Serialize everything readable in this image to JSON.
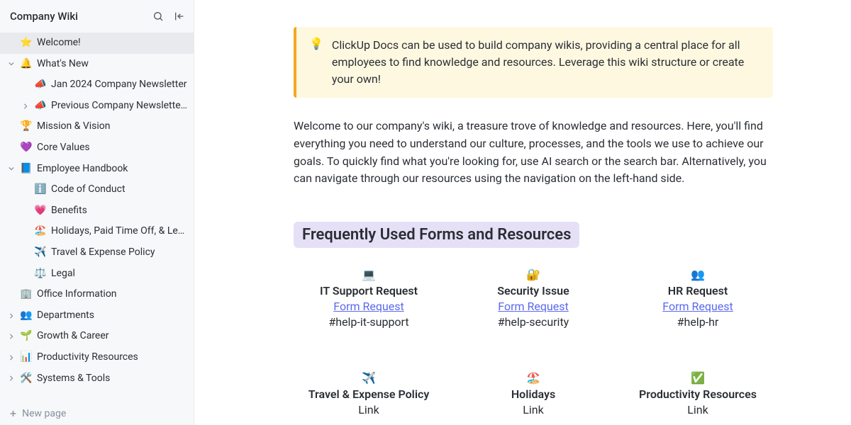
{
  "sidebar": {
    "title": "Company Wiki",
    "new_page_label": "New page",
    "items": [
      {
        "label": "Welcome!",
        "icon": "⭐",
        "depth": 1,
        "expandable": false,
        "expanded": false,
        "active": true
      },
      {
        "label": "What's New",
        "icon": "🔔",
        "depth": 1,
        "expandable": true,
        "expanded": true,
        "active": false
      },
      {
        "label": "Jan 2024 Company Newsletter",
        "icon": "📣",
        "depth": 2,
        "expandable": false,
        "expanded": false,
        "active": false
      },
      {
        "label": "Previous Company Newsletters",
        "icon": "📣",
        "depth": 2,
        "expandable": true,
        "expanded": false,
        "active": false
      },
      {
        "label": "Mission & Vision",
        "icon": "🏆",
        "depth": 1,
        "expandable": false,
        "expanded": false,
        "active": false
      },
      {
        "label": "Core Values",
        "icon": "💜",
        "depth": 1,
        "expandable": false,
        "expanded": false,
        "active": false
      },
      {
        "label": "Employee Handbook",
        "icon": "📘",
        "depth": 1,
        "expandable": true,
        "expanded": true,
        "active": false
      },
      {
        "label": "Code of Conduct",
        "icon": "ℹ️",
        "depth": 3,
        "expandable": false,
        "expanded": false,
        "active": false
      },
      {
        "label": "Benefits",
        "icon": "💗",
        "depth": 3,
        "expandable": false,
        "expanded": false,
        "active": false
      },
      {
        "label": "Holidays, Paid Time Off, & Leave...",
        "icon": "🏖️",
        "depth": 3,
        "expandable": false,
        "expanded": false,
        "active": false
      },
      {
        "label": "Travel & Expense Policy",
        "icon": "✈️",
        "depth": 3,
        "expandable": false,
        "expanded": false,
        "active": false
      },
      {
        "label": "Legal",
        "icon": "⚖️",
        "depth": 3,
        "expandable": false,
        "expanded": false,
        "active": false
      },
      {
        "label": "Office Information",
        "icon": "🏢",
        "depth": 1,
        "expandable": false,
        "expanded": false,
        "active": false
      },
      {
        "label": "Departments",
        "icon": "👥",
        "depth": 1,
        "expandable": true,
        "expanded": false,
        "active": false
      },
      {
        "label": "Growth & Career",
        "icon": "🌱",
        "depth": 1,
        "expandable": true,
        "expanded": false,
        "active": false
      },
      {
        "label": "Productivity Resources",
        "icon": "📊",
        "depth": 1,
        "expandable": true,
        "expanded": false,
        "active": false
      },
      {
        "label": "Systems & Tools",
        "icon": "🛠️",
        "depth": 1,
        "expandable": true,
        "expanded": false,
        "active": false
      }
    ]
  },
  "main": {
    "callout": {
      "icon": "💡",
      "text": "ClickUp Docs can be used to build company wikis, providing a central place for all employees to find knowledge and resources. Leverage this wiki structure or create your own!"
    },
    "intro": "Welcome to our company's wiki, a treasure trove of knowledge and resources. Here, you'll find everything you need to understand our culture, processes, and the tools we use to achieve our goals. To quickly find what you're looking for, use AI search or the search bar. Alternatively, you can navigate through our resources using the navigation on the left-hand side.",
    "section_heading": "Frequently Used Forms and Resources",
    "cards": [
      {
        "emoji": "💻",
        "title": "IT Support Request",
        "link_text": "Form Request",
        "is_link": true,
        "sub": "#help-it-support"
      },
      {
        "emoji": "🔐",
        "title": "Security Issue",
        "link_text": "Form Request",
        "is_link": true,
        "sub": "#help-security"
      },
      {
        "emoji": "👥",
        "title": "HR Request",
        "link_text": "Form Request",
        "is_link": true,
        "sub": "#help-hr"
      },
      {
        "emoji": "✈️",
        "title": "Travel & Expense Policy",
        "link_text": "Link",
        "is_link": false,
        "sub": ""
      },
      {
        "emoji": "🏖️",
        "title": "Holidays",
        "link_text": "Link",
        "is_link": false,
        "sub": ""
      },
      {
        "emoji": "✅",
        "title": "Productivity Resources",
        "link_text": "Link",
        "is_link": false,
        "sub": ""
      }
    ]
  }
}
